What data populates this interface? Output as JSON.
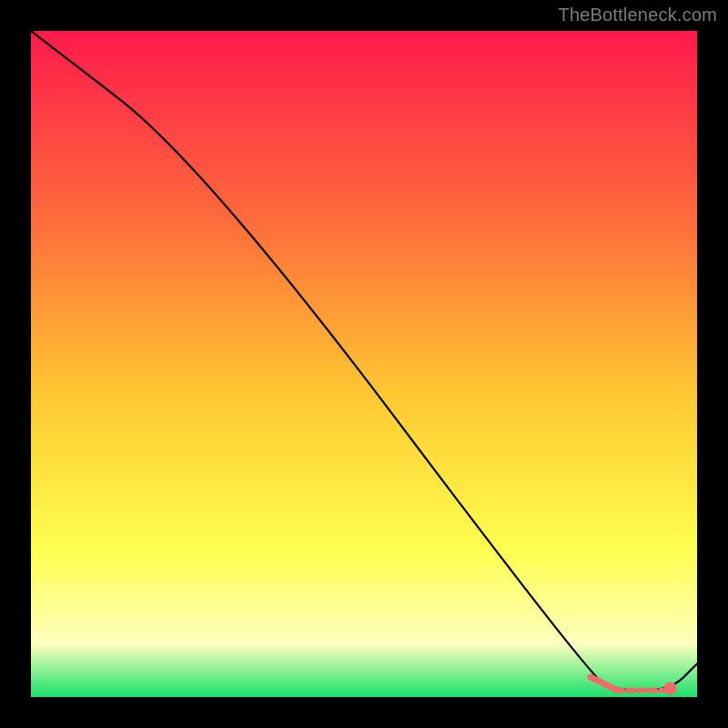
{
  "watermark": "TheBottleneck.com",
  "colors": {
    "gradient_top": "#ff1a4c",
    "gradient_mid_upper": "#ff6a3c",
    "gradient_mid": "#ffc932",
    "gradient_mid_lower": "#ffff50",
    "gradient_pale": "#ffffc0",
    "gradient_bottom": "#18e06a",
    "line": "#000000",
    "marker": "#ef6b6b",
    "background": "#000000"
  },
  "chart_data": {
    "type": "line",
    "title": "",
    "xlabel": "",
    "ylabel": "",
    "xlim": [
      0,
      100
    ],
    "ylim": [
      0,
      100
    ],
    "series": [
      {
        "name": "curve",
        "x": [
          0,
          26,
          84,
          88,
          96,
          100
        ],
        "values": [
          100,
          80,
          3,
          1,
          1,
          5
        ]
      }
    ],
    "markers": {
      "line_segment": {
        "x1": 84,
        "y1": 3,
        "x2": 88,
        "y2": 1
      },
      "dashed_segment": {
        "x1": 88,
        "y1": 1,
        "x2": 95,
        "y2": 1
      },
      "point": {
        "x": 96,
        "y": 1.3
      }
    }
  }
}
